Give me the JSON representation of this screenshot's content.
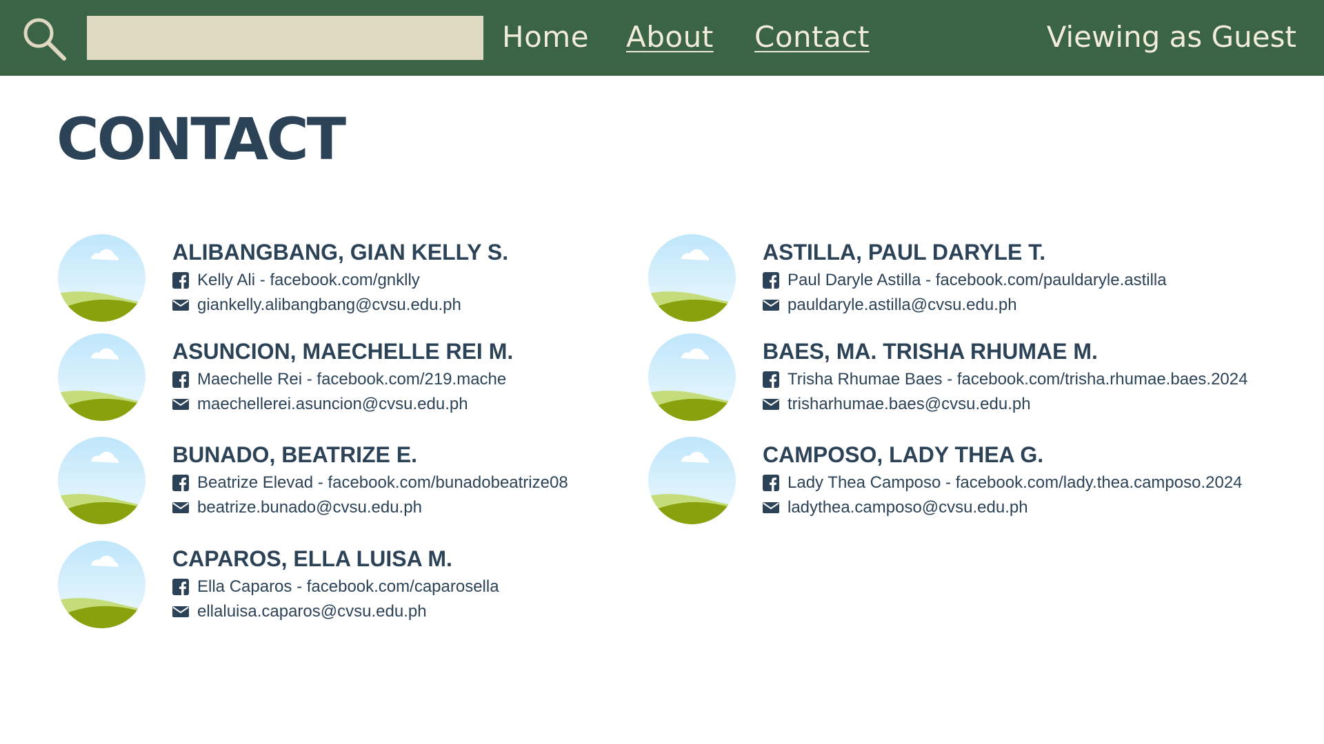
{
  "header": {
    "search": {
      "value": "",
      "placeholder": ""
    },
    "nav": {
      "home": "Home",
      "about": "About",
      "contact": "Contact"
    },
    "viewer_status": "Viewing as Guest"
  },
  "page_title": "CONTACT",
  "contacts": [
    {
      "name": "ALIBANGBANG, GIAN KELLY S.",
      "facebook": "Kelly Ali - facebook.com/gnklly",
      "email": "giankelly.alibangbang@cvsu.edu.ph"
    },
    {
      "name": "ASTILLA, PAUL DARYLE T.",
      "facebook": "Paul Daryle Astilla - facebook.com/pauldaryle.astilla",
      "email": "pauldaryle.astilla@cvsu.edu.ph"
    },
    {
      "name": "ASUNCION, MAECHELLE REI M.",
      "facebook": "Maechelle Rei - facebook.com/219.mache",
      "email": "maechellerei.asuncion@cvsu.edu.ph"
    },
    {
      "name": "BAES, MA. TRISHA RHUMAE M.",
      "facebook": "Trisha Rhumae Baes - facebook.com/trisha.rhumae.baes.2024",
      "email": "trisharhumae.baes@cvsu.edu.ph"
    },
    {
      "name": "BUNADO, BEATRIZE E.",
      "facebook": "Beatrize Elevad - facebook.com/bunadobeatrize08",
      "email": "beatrize.bunado@cvsu.edu.ph"
    },
    {
      "name": "CAMPOSO, LADY THEA G.",
      "facebook": "Lady Thea Camposo - facebook.com/lady.thea.camposo.2024",
      "email": "ladythea.camposo@cvsu.edu.ph"
    },
    {
      "name": "CAPAROS, ELLA LUISA M.",
      "facebook": "Ella Caparos - facebook.com/caparosella",
      "email": "ellaluisa.caparos@cvsu.edu.ph"
    }
  ],
  "icons": {
    "search": "search-icon",
    "facebook": "facebook-icon",
    "email": "envelope-icon",
    "avatar": "placeholder-landscape-avatar"
  },
  "colors": {
    "header_bg": "#3b6446",
    "header_text": "#f2ecda",
    "search_bg": "#e0d9c1",
    "text_primary": "#2b4257"
  }
}
